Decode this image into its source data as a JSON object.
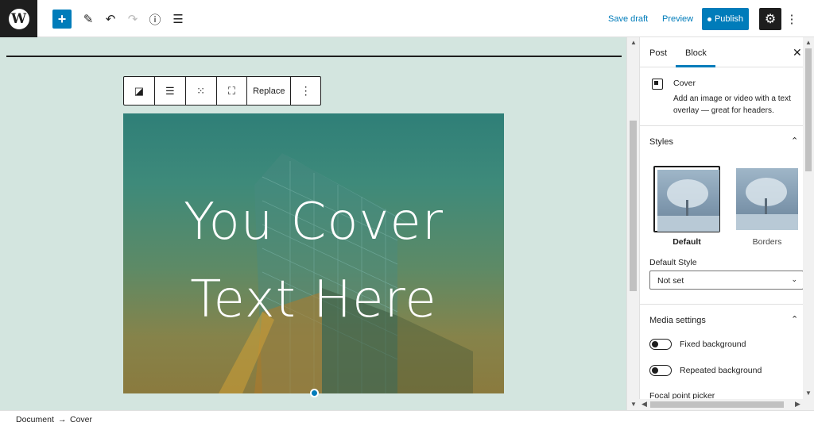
{
  "topbar": {
    "logo_letter": "W",
    "add_icon": "+",
    "pen_icon": "✎",
    "undo_icon": "↶",
    "redo_icon": "↷",
    "info_icon": "ⓘ",
    "outline_icon": "☰",
    "save_draft": "Save draft",
    "preview": "Preview",
    "publish": "Publish",
    "settings_icon": "⚙",
    "more_icon": "⋮"
  },
  "block_toolbar": {
    "cover_icon": "◪",
    "align_icon": "☰",
    "position_icon": "⁙",
    "fullheight_icon": "⛶",
    "replace": "Replace",
    "more_icon": "⋮"
  },
  "cover": {
    "line1": "You Cover",
    "line2": "Text Here",
    "overlay_top": "#2f7f78",
    "overlay_bottom": "#8a7a3e"
  },
  "sidebar": {
    "tabs": [
      {
        "label": "Post"
      },
      {
        "label": "Block"
      }
    ],
    "close_icon": "✕",
    "block_card": {
      "title": "Cover",
      "description": "Add an image or video with a text overlay — great for headers."
    },
    "styles": {
      "title": "Styles",
      "chevron": "⌃",
      "options": [
        {
          "label": "Default",
          "selected": true
        },
        {
          "label": "Borders",
          "selected": false
        }
      ],
      "default_style_label": "Default Style",
      "default_style_value": "Not set",
      "select_chevron": "⌄"
    },
    "media": {
      "title": "Media settings",
      "chevron": "⌃",
      "toggles": [
        {
          "label": "Fixed background",
          "on": false
        },
        {
          "label": "Repeated background",
          "on": false
        }
      ],
      "focal_label": "Focal point picker"
    }
  },
  "breadcrumb": {
    "items": [
      "Document",
      "Cover"
    ],
    "separator": "→"
  },
  "colors": {
    "accent": "#007cba",
    "canvas_bg": "#d3e5df",
    "dark": "#1e1e1e"
  }
}
